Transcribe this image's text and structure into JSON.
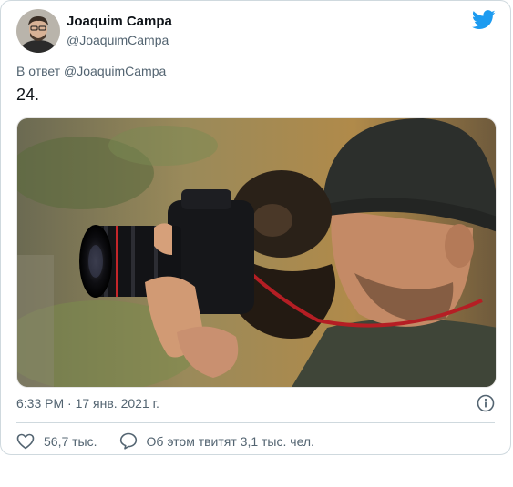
{
  "author": {
    "name": "Joaquim Campa",
    "handle": "@JoaquimCampa"
  },
  "reply_context": {
    "prefix": "В ответ",
    "mention": "@JoaquimCampa"
  },
  "tweet": {
    "text": "24.",
    "timestamp": "6:33 PM · 17 янв. 2021 г."
  },
  "actions": {
    "like_count": "56,7 тыс.",
    "discussion_label": "Об этом твитят 3,1 тыс. чел."
  },
  "icons": {
    "brand": "twitter-bird-icon",
    "info": "info-icon",
    "like": "heart-icon",
    "reply": "speech-bubble-icon"
  },
  "colors": {
    "brand_blue": "#1d9bf0",
    "text_primary": "#0f1419",
    "text_secondary": "#536471",
    "border": "#cfd9de"
  }
}
